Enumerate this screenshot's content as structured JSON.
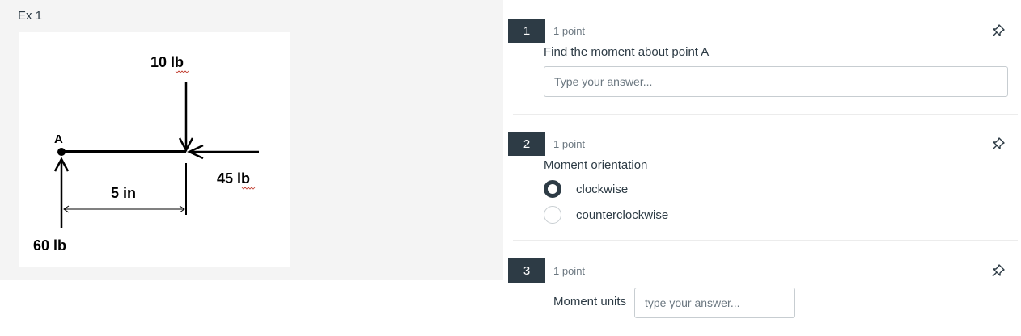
{
  "example": {
    "title": "Ex 1",
    "figure": {
      "point_label": "A",
      "force_top": "10 lb",
      "force_right": "45 lb",
      "force_bottom": "60 lb",
      "distance": "5 in"
    }
  },
  "questions": [
    {
      "number": "1",
      "points": "1 point",
      "text": "Find the moment about point A",
      "placeholder": "Type your answer...",
      "icon": "pin-icon"
    },
    {
      "number": "2",
      "points": "1 point",
      "text": "Moment orientation",
      "options": [
        "clockwise",
        "counterclockwise"
      ],
      "selected": "clockwise",
      "icon": "pin-icon"
    },
    {
      "number": "3",
      "points": "1 point",
      "label": "Moment units",
      "placeholder": "type your answer...",
      "icon": "pin-icon"
    }
  ],
  "colors": {
    "accent": "#2d3b45",
    "panel_bg": "#f4f4f4",
    "border": "#c7cdd1"
  }
}
